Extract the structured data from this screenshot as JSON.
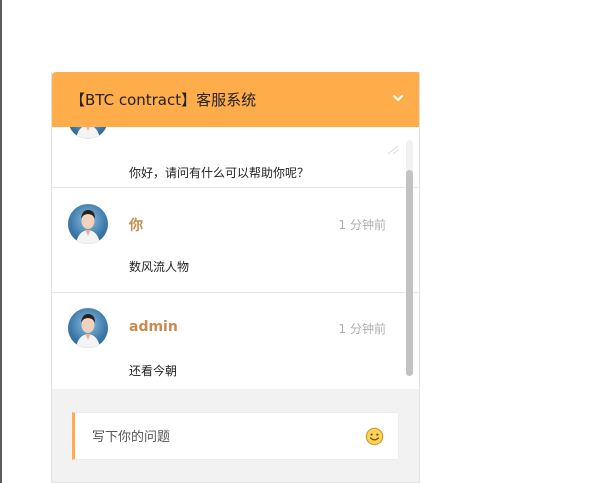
{
  "header": {
    "title": "【BTC contract】客服系统",
    "collapse_icon": "chevron-down-icon",
    "background": "#ffad4b"
  },
  "messages": [
    {
      "sender": "",
      "time": "",
      "text": "你好，请问有什么可以帮助你呢？"
    },
    {
      "sender": "你",
      "time": "1 分钟前",
      "text": "数风流人物"
    },
    {
      "sender": "admin",
      "time": "1 分钟前",
      "text": "还看今朝"
    }
  ],
  "compose": {
    "placeholder": "写下你的问题",
    "emoji_icon": "smiley-icon"
  },
  "colors": {
    "accent": "#ffad4b",
    "sender": "#c98a4e",
    "time": "#b0b0b0"
  }
}
